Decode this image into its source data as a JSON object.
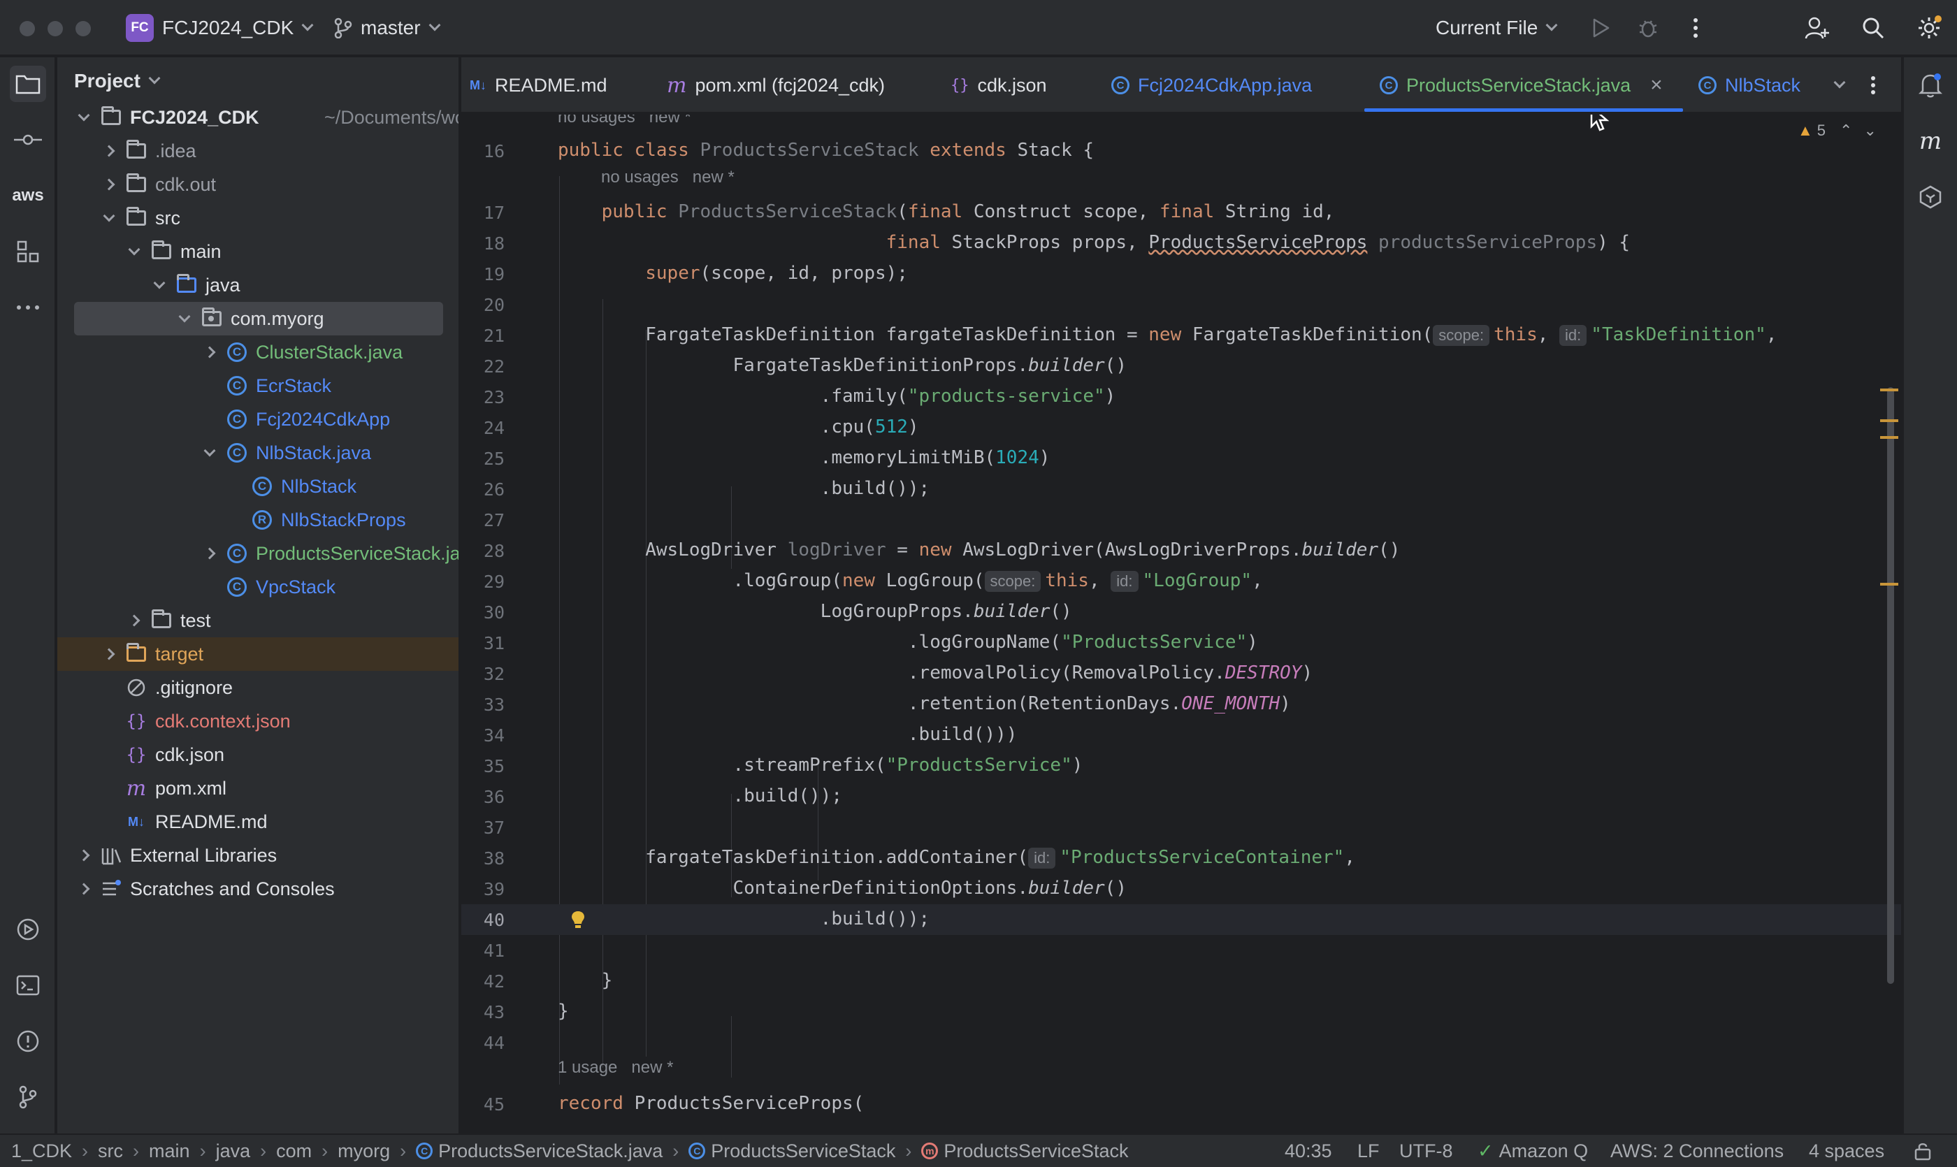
{
  "titlebar": {
    "project_badge": "FC",
    "project_name": "FCJ2024_CDK",
    "branch": "master",
    "run_config": "Current File"
  },
  "project_panel": {
    "title": "Project",
    "tree": [
      {
        "label": "FCJ2024_CDK",
        "suffix": "~/Documents/workshop",
        "icon": "module-folder-icon",
        "depth": 0,
        "state": "expanded",
        "color": "#dfe1e5"
      },
      {
        "label": ".idea",
        "icon": "folder-icon",
        "depth": 1,
        "state": "collapsed",
        "color": "#9da0a8"
      },
      {
        "label": "cdk.out",
        "icon": "folder-icon",
        "depth": 1,
        "state": "collapsed",
        "color": "#9da0a8"
      },
      {
        "label": "src",
        "icon": "folder-icon",
        "depth": 1,
        "state": "expanded",
        "color": "#dfe1e5"
      },
      {
        "label": "main",
        "icon": "folder-icon",
        "depth": 2,
        "state": "expanded",
        "color": "#dfe1e5"
      },
      {
        "label": "java",
        "icon": "source-folder-icon",
        "depth": 3,
        "state": "expanded",
        "color": "#dfe1e5"
      },
      {
        "label": "com.myorg",
        "icon": "package-icon",
        "depth": 4,
        "state": "expanded",
        "color": "#dfe1e5",
        "selected": true
      },
      {
        "label": "ClusterStack.java",
        "icon": "class-icon",
        "depth": 5,
        "state": "collapsed",
        "color": "#73bd79"
      },
      {
        "label": "EcrStack",
        "icon": "class-icon",
        "depth": 5,
        "state": "none",
        "color": "#548af7"
      },
      {
        "label": "Fcj2024CdkApp",
        "icon": "class-icon",
        "depth": 5,
        "state": "none",
        "color": "#548af7"
      },
      {
        "label": "NlbStack.java",
        "icon": "class-icon",
        "depth": 5,
        "state": "expanded",
        "color": "#548af7"
      },
      {
        "label": "NlbStack",
        "icon": "class-icon",
        "depth": 6,
        "state": "none",
        "color": "#548af7"
      },
      {
        "label": "NlbStackProps",
        "icon": "record-icon",
        "depth": 6,
        "state": "none",
        "color": "#548af7"
      },
      {
        "label": "ProductsServiceStack.java",
        "icon": "class-icon",
        "depth": 5,
        "state": "collapsed",
        "color": "#73bd79"
      },
      {
        "label": "VpcStack",
        "icon": "class-icon",
        "depth": 5,
        "state": "none",
        "color": "#548af7"
      },
      {
        "label": "test",
        "icon": "folder-icon",
        "depth": 2,
        "state": "collapsed",
        "color": "#dfe1e5"
      },
      {
        "label": "target",
        "icon": "folder-icon",
        "depth": 1,
        "state": "collapsed",
        "color": "#e0a559",
        "excluded": true
      },
      {
        "label": ".gitignore",
        "icon": "ignore-file-icon",
        "depth": 1,
        "state": "none",
        "color": "#dfe1e5"
      },
      {
        "label": "cdk.context.json",
        "icon": "json-icon",
        "depth": 1,
        "state": "none",
        "color": "#e47b75"
      },
      {
        "label": "cdk.json",
        "icon": "json-icon",
        "depth": 1,
        "state": "none",
        "color": "#dfe1e5"
      },
      {
        "label": "pom.xml",
        "icon": "maven-icon",
        "depth": 1,
        "state": "none",
        "color": "#dfe1e5"
      },
      {
        "label": "README.md",
        "icon": "markdown-icon",
        "depth": 1,
        "state": "none",
        "color": "#dfe1e5"
      },
      {
        "label": "External Libraries",
        "icon": "libraries-icon",
        "depth": 0,
        "state": "collapsed",
        "color": "#dfe1e5"
      },
      {
        "label": "Scratches and Consoles",
        "icon": "scratches-icon",
        "depth": 0,
        "state": "collapsed",
        "color": "#dfe1e5"
      }
    ]
  },
  "tabs": [
    {
      "label": "README.md",
      "icon": "markdown-icon",
      "icon_text": "M↓",
      "color": "#dfe1e5"
    },
    {
      "label": "pom.xml (fcj2024_cdk)",
      "icon": "maven-icon",
      "icon_text": "m",
      "color": "#dfe1e5"
    },
    {
      "label": "cdk.json",
      "icon": "json-icon",
      "icon_text": "{}",
      "color": "#dfe1e5"
    },
    {
      "label": "Fcj2024CdkApp.java",
      "icon": "class-icon",
      "icon_text": "C",
      "color": "#548af7"
    },
    {
      "label": "ProductsServiceStack.java",
      "icon": "class-icon",
      "icon_text": "C",
      "color": "#73bd79",
      "active": true
    },
    {
      "label": "NlbStack",
      "icon": "class-icon",
      "icon_text": "C",
      "color": "#548af7"
    }
  ],
  "editor": {
    "warnings_count": "5",
    "inlays": {
      "top": "no usages   new *",
      "constructor": "no usages   new *",
      "record": "1 usage   new *"
    },
    "line_numbers": [
      "16",
      "17",
      "18",
      "19",
      "20",
      "21",
      "22",
      "23",
      "24",
      "25",
      "26",
      "27",
      "28",
      "29",
      "30",
      "31",
      "32",
      "33",
      "34",
      "35",
      "36",
      "37",
      "38",
      "39",
      "40",
      "41",
      "42",
      "43",
      "44",
      "45"
    ],
    "current_line": "40"
  },
  "statusbar": {
    "breadcrumbs": [
      "1_CDK",
      "src",
      "main",
      "java",
      "com",
      "myorg",
      "ProductsServiceStack.java",
      "ProductsServiceStack",
      "ProductsServiceStack"
    ],
    "position": "40:35",
    "line_sep": "LF",
    "encoding": "UTF-8",
    "amazon_q": "Amazon Q",
    "aws": "AWS: 2 Connections",
    "indent": "4 spaces"
  }
}
